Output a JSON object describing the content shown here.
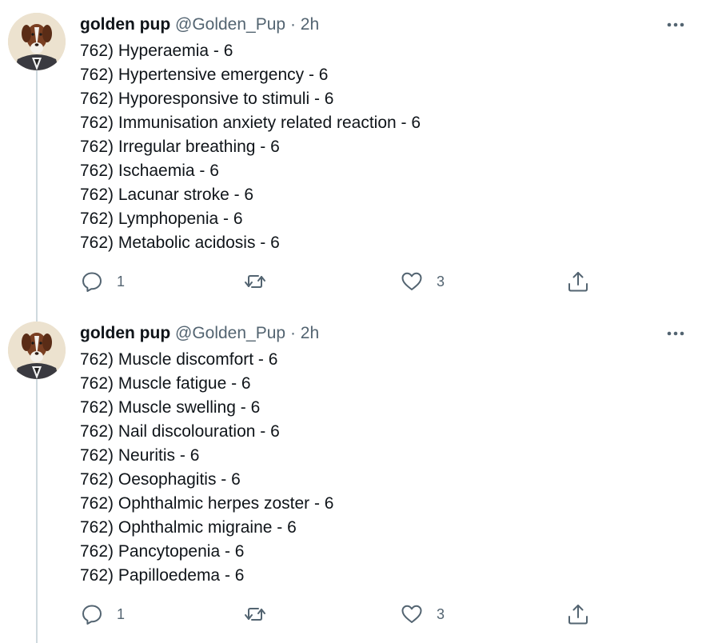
{
  "tweets": [
    {
      "author": {
        "name": "golden pup",
        "handle": "@Golden_Pup",
        "separator": "·",
        "time": "2h"
      },
      "lines": [
        "762) Hyperaemia - 6",
        "762) Hypertensive emergency - 6",
        "762) Hyporesponsive to stimuli - 6",
        "762) Immunisation anxiety related reaction - 6",
        "762) Irregular breathing - 6",
        "762) Ischaemia - 6",
        "762) Lacunar stroke - 6",
        "762) Lymphopenia - 6",
        "762) Metabolic acidosis - 6"
      ],
      "actions": {
        "replies": "1",
        "retweets": "",
        "likes": "3"
      }
    },
    {
      "author": {
        "name": "golden pup",
        "handle": "@Golden_Pup",
        "separator": "·",
        "time": "2h"
      },
      "lines": [
        "762) Muscle discomfort - 6",
        "762) Muscle fatigue - 6",
        "762) Muscle swelling - 6",
        "762) Nail discolouration - 6",
        "762) Neuritis - 6",
        "762) Oesophagitis - 6",
        "762) Ophthalmic herpes zoster - 6",
        "762) Ophthalmic migraine - 6",
        "762) Pancytopenia - 6",
        "762) Papilloedema - 6"
      ],
      "actions": {
        "replies": "1",
        "retweets": "",
        "likes": "3"
      }
    }
  ],
  "icons": {
    "avatar": "dog-avatar-icon",
    "more": "more-options-icon",
    "reply": "reply-icon",
    "retweet": "retweet-icon",
    "like": "heart-icon",
    "share": "share-icon"
  },
  "colors": {
    "text": "#0f1419",
    "secondary": "#536471",
    "thread_line": "#cfd9de"
  }
}
